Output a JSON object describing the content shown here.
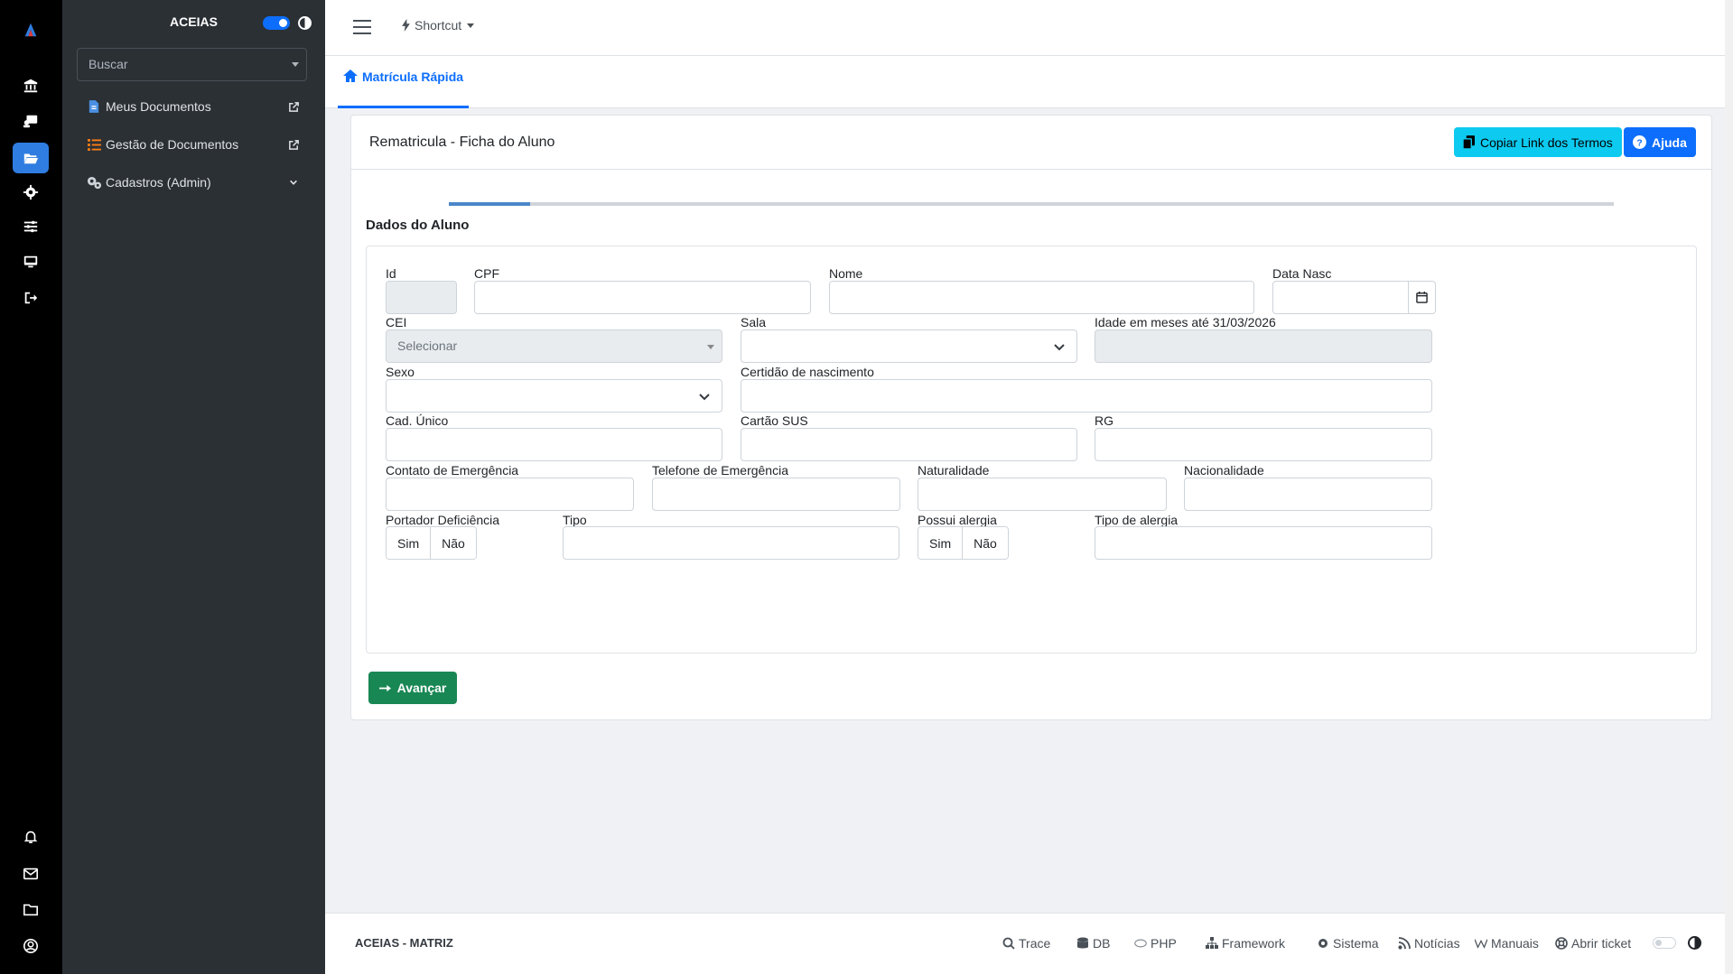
{
  "sidebar": {
    "title": "ACEIAS",
    "search_placeholder": "Buscar",
    "items": [
      {
        "label": "Meus Documentos"
      },
      {
        "label": "Gestão de Documentos"
      },
      {
        "label": "Cadastros (Admin)"
      }
    ]
  },
  "topbar": {
    "shortcut_label": "Shortcut"
  },
  "tabs": [
    {
      "label": "Matrícula Rápida"
    }
  ],
  "card": {
    "title": "Rematricula - Ficha do Aluno",
    "copy_button": "Copiar Link dos Termos",
    "help_button": "Ajuda",
    "progress_fraction": 0.07,
    "section_title": "Dados do Aluno"
  },
  "form": {
    "id_label": "Id",
    "cpf_label": "CPF",
    "nome_label": "Nome",
    "data_nasc_label": "Data Nasc",
    "cei_label": "CEI",
    "cei_value": "Selecionar",
    "sala_label": "Sala",
    "idade_label": "Idade em meses até 31/03/2026",
    "sexo_label": "Sexo",
    "certidao_label": "Certidão de nascimento",
    "cad_unico_label": "Cad. Único",
    "cartao_sus_label": "Cartão SUS",
    "rg_label": "RG",
    "contato_label": "Contato de Emergência",
    "telefone_label": "Telefone de Emergência",
    "naturalidade_label": "Naturalidade",
    "nacionalidade_label": "Nacionalidade",
    "deficiencia_label": "Portador Deficiência",
    "tipo_label": "Tipo",
    "alergia_label": "Possui alergia",
    "tipo_alergia_label": "Tipo de alergia",
    "yes_label": "Sim",
    "no_label": "Não",
    "next_button": "Avançar"
  },
  "footer": {
    "brand": "ACEIAS - MATRIZ",
    "links": [
      "Trace",
      "DB",
      "PHP",
      "Framework",
      "Sistema",
      "Notícias",
      "Manuais",
      "Abrir ticket"
    ]
  },
  "colors": {
    "primary": "#0d6efd",
    "info": "#0dcaf0",
    "success": "#198754",
    "sidebar": "#2b3035",
    "rail": "#000000"
  }
}
